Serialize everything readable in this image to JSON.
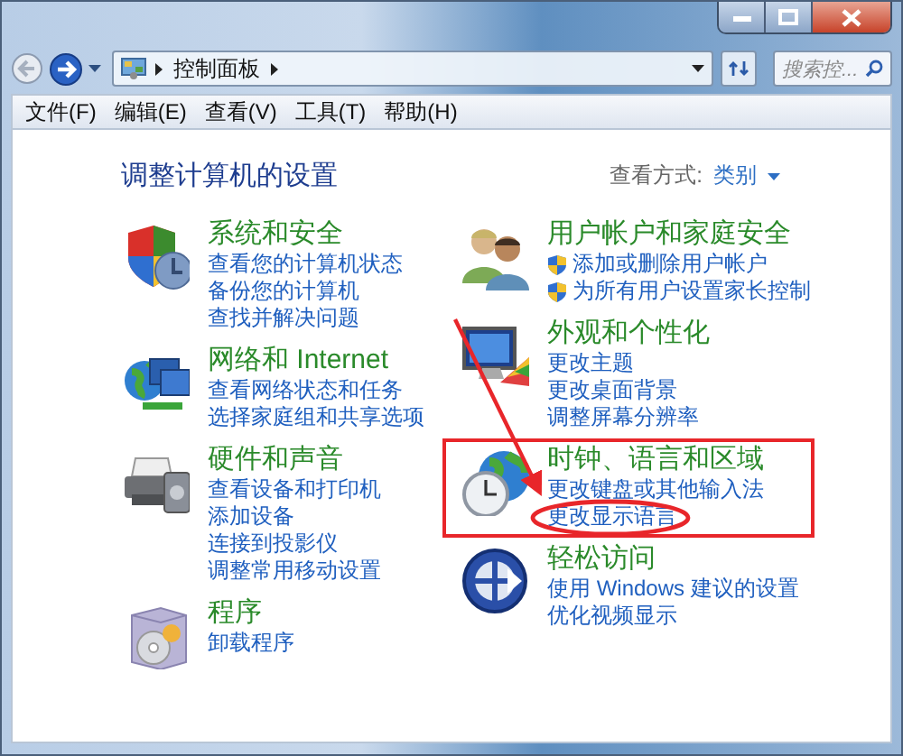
{
  "address": {
    "segments": [
      "控制面板"
    ]
  },
  "search": {
    "placeholder": "搜索控..."
  },
  "menu": [
    "文件(F)",
    "编辑(E)",
    "查看(V)",
    "工具(T)",
    "帮助(H)"
  ],
  "heading": "调整计算机的设置",
  "view_by": {
    "label": "查看方式:",
    "value": "类别"
  },
  "columns": [
    [
      {
        "title": "系统和安全",
        "links": [
          {
            "text": "查看您的计算机状态",
            "shield": false
          },
          {
            "text": "备份您的计算机",
            "shield": false
          },
          {
            "text": "查找并解决问题",
            "shield": false
          }
        ]
      },
      {
        "title": "网络和 Internet",
        "links": [
          {
            "text": "查看网络状态和任务",
            "shield": false
          },
          {
            "text": "选择家庭组和共享选项",
            "shield": false
          }
        ]
      },
      {
        "title": "硬件和声音",
        "links": [
          {
            "text": "查看设备和打印机",
            "shield": false
          },
          {
            "text": "添加设备",
            "shield": false
          },
          {
            "text": "连接到投影仪",
            "shield": false
          },
          {
            "text": "调整常用移动设置",
            "shield": false
          }
        ]
      },
      {
        "title": "程序",
        "links": [
          {
            "text": "卸载程序",
            "shield": false
          }
        ]
      }
    ],
    [
      {
        "title": "用户帐户和家庭安全",
        "links": [
          {
            "text": "添加或删除用户帐户",
            "shield": true
          },
          {
            "text": "为所有用户设置家长控制",
            "shield": true
          }
        ]
      },
      {
        "title": "外观和个性化",
        "links": [
          {
            "text": "更改主题",
            "shield": false
          },
          {
            "text": "更改桌面背景",
            "shield": false
          },
          {
            "text": "调整屏幕分辨率",
            "shield": false
          }
        ]
      },
      {
        "title": "时钟、语言和区域",
        "links": [
          {
            "text": "更改键盘或其他输入法",
            "shield": false
          },
          {
            "text": "更改显示语言",
            "shield": false
          }
        ]
      },
      {
        "title": "轻松访问",
        "links": [
          {
            "text": "使用 Windows 建议的设置",
            "shield": false
          },
          {
            "text": "优化视频显示",
            "shield": false
          }
        ]
      }
    ]
  ]
}
